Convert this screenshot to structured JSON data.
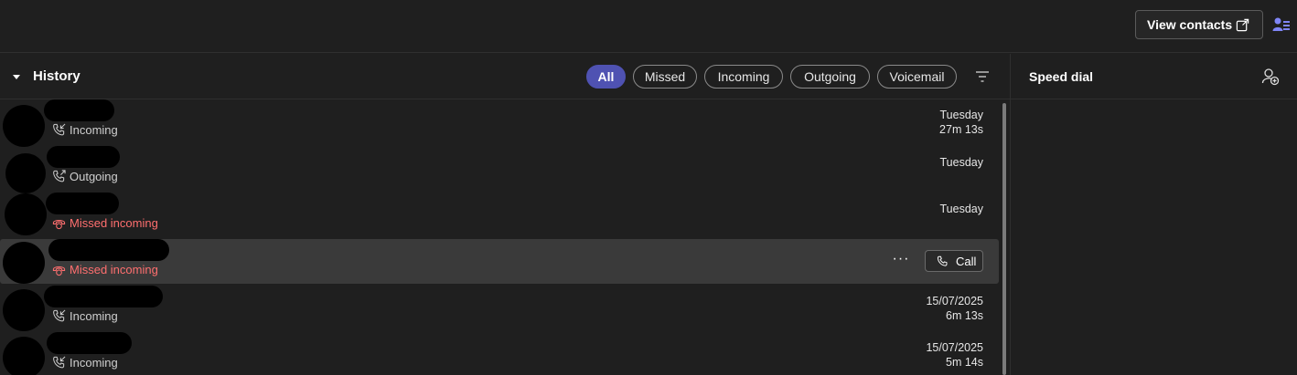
{
  "topbar": {
    "view_contacts_label": "View contacts"
  },
  "history": {
    "title": "History",
    "filters": [
      {
        "label": "All",
        "active": true
      },
      {
        "label": "Missed",
        "active": false
      },
      {
        "label": "Incoming",
        "active": false
      },
      {
        "label": "Outgoing",
        "active": false
      },
      {
        "label": "Voicemail",
        "active": false
      }
    ],
    "rows": [
      {
        "type": "Incoming",
        "date": "Tuesday",
        "duration": "27m 13s"
      },
      {
        "type": "Outgoing",
        "date": "Tuesday",
        "duration": ""
      },
      {
        "type": "Missed incoming",
        "date": "Tuesday",
        "duration": ""
      },
      {
        "type": "Missed incoming",
        "date": "",
        "duration": "",
        "call_label": "Call",
        "more_label": "···"
      },
      {
        "type": "Incoming",
        "date": "15/07/2025",
        "duration": "6m 13s"
      },
      {
        "type": "Incoming",
        "date": "15/07/2025",
        "duration": "5m 14s"
      }
    ]
  },
  "speed_dial": {
    "title": "Speed dial"
  },
  "colors": {
    "accent": "#4f52b2",
    "missed": "#ff6f6f",
    "background": "#1f1f1f",
    "hover": "#3a3a3a"
  },
  "icons": [
    "external-link-icon",
    "people-icon",
    "chevron-down-icon",
    "filter-icon",
    "add-person-icon",
    "incoming-call-icon",
    "outgoing-call-icon",
    "missed-call-icon",
    "phone-icon",
    "more-icon"
  ]
}
